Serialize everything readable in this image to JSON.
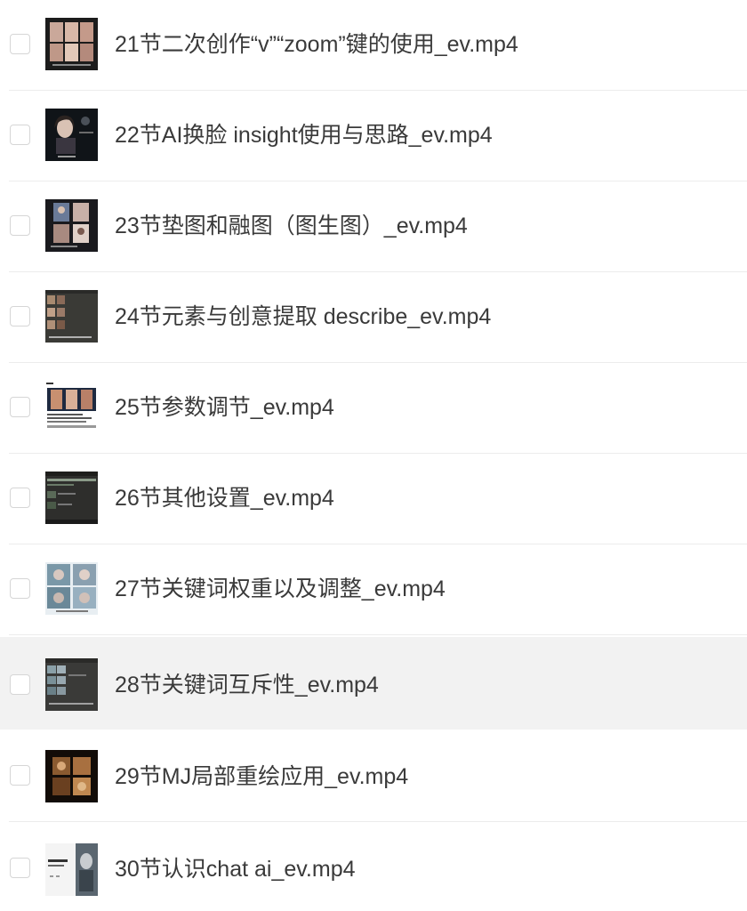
{
  "files": [
    {
      "name": "21节二次创作“v”“zoom”键的使用_ev.mp4",
      "selected": false,
      "thumbnail_icon": "video-thumbnail-icon"
    },
    {
      "name": "22节AI换脸 insight使用与思路_ev.mp4",
      "selected": false,
      "thumbnail_icon": "video-thumbnail-icon"
    },
    {
      "name": "23节垫图和融图（图生图）_ev.mp4",
      "selected": false,
      "thumbnail_icon": "video-thumbnail-icon"
    },
    {
      "name": "24节元素与创意提取 describe_ev.mp4",
      "selected": false,
      "thumbnail_icon": "video-thumbnail-icon"
    },
    {
      "name": "25节参数调节_ev.mp4",
      "selected": false,
      "thumbnail_icon": "video-thumbnail-icon"
    },
    {
      "name": "26节其他设置_ev.mp4",
      "selected": false,
      "thumbnail_icon": "video-thumbnail-icon"
    },
    {
      "name": "27节关键词权重以及调整_ev.mp4",
      "selected": false,
      "thumbnail_icon": "video-thumbnail-icon"
    },
    {
      "name": "28节关键词互斥性_ev.mp4",
      "selected": true,
      "thumbnail_icon": "video-thumbnail-icon"
    },
    {
      "name": "29节MJ局部重绘应用_ev.mp4",
      "selected": false,
      "thumbnail_icon": "video-thumbnail-icon"
    },
    {
      "name": "30节认识chat ai_ev.mp4",
      "selected": false,
      "thumbnail_icon": "video-thumbnail-icon"
    }
  ],
  "colors": {
    "text": "#3a3a3a",
    "selected_row_bg": "#f2f2f2",
    "divider": "#ececec",
    "checkbox_border": "#d6d6d6"
  }
}
